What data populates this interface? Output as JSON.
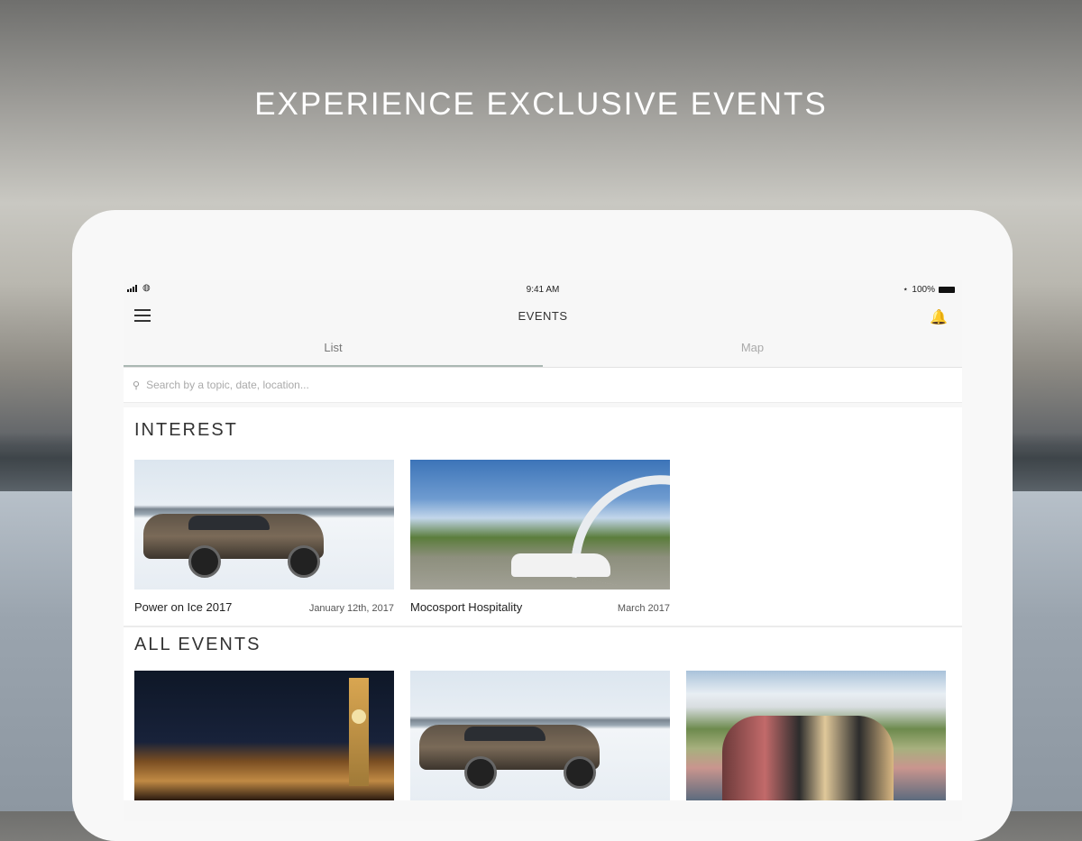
{
  "headline": "EXPERIENCE EXCLUSIVE EVENTS",
  "statusbar": {
    "time": "9:41 AM",
    "battery": "100%"
  },
  "navbar": {
    "title": "EVENTS"
  },
  "tabs": [
    {
      "label": "List",
      "active": true
    },
    {
      "label": "Map",
      "active": false
    }
  ],
  "search": {
    "placeholder": "Search by a topic, date, location..."
  },
  "interest": {
    "title": "INTEREST",
    "cards": [
      {
        "name": "Power on Ice 2017",
        "date": "January 12th, 2017",
        "image": "snow-suv-photo"
      },
      {
        "name": "Mocosport Hospitality",
        "date": "March 2017",
        "image": "racing-festival-photo"
      }
    ]
  },
  "all_events": {
    "title": "ALL EVENTS",
    "cards": [
      {
        "image": "parliament-night-photo"
      },
      {
        "image": "snow-suv-photo"
      },
      {
        "image": "garden-crowd-photo"
      }
    ]
  },
  "colors": {
    "tab_indicator": "#aab8b3",
    "screen_bg": "#f7f7f7",
    "headline": "#ffffff"
  },
  "icons": [
    "signal-icon",
    "wifi-icon",
    "bluetooth-icon",
    "battery-icon",
    "menu-icon",
    "bell-icon",
    "search-icon"
  ]
}
